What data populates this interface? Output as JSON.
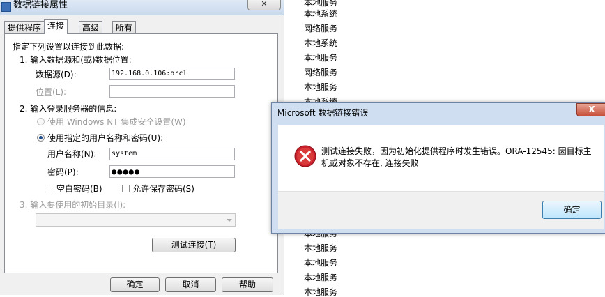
{
  "prop_dialog": {
    "title": "数据链接属性",
    "close_glyph": "✕",
    "tabs": [
      {
        "label": "提供程序"
      },
      {
        "label": "连接"
      },
      {
        "label": "高级"
      },
      {
        "label": "所有"
      }
    ],
    "intro": "指定下列设置以连接到此数据:",
    "step1": "1. 输入数据源和(或)数据位置:",
    "datasource_label": "数据源(D):",
    "datasource_value": "192.168.0.106:orcl",
    "location_label": "位置(L):",
    "location_value": "",
    "step2": "2. 输入登录服务器的信息:",
    "radio_windows": "使用 Windows NT 集成安全设置(W)",
    "radio_specific": "使用指定的用户名称和密码(U):",
    "username_label": "用户名称(N):",
    "username_value": "system",
    "password_label": "密码(P):",
    "password_value": "●●●●●",
    "blank_password": "空白密码(B)",
    "save_password": "允许保存密码(S)",
    "step3": "3. 输入要使用的初始目录(I):",
    "initial_catalog": "",
    "test_button": "测试连接(T)",
    "ok_button": "确定",
    "cancel_button": "取消",
    "help_button": "帮助"
  },
  "background_list": {
    "blurred_top": "服务",
    "items": [
      "本地服务",
      "本地系统",
      "网络服务",
      "本地系统",
      "本地服务",
      "网络服务",
      "本地服务",
      "本地系统",
      "本地服务",
      "本地服务",
      "本地服务",
      "本地服务",
      "本地服务"
    ]
  },
  "error_dialog": {
    "title": "Microsoft 数据链接错误",
    "close_glyph": "X",
    "message": "测试连接失败，因为初始化提供程序时发生错误。ORA-12545: 因目标主机或对象不存在, 连接失败",
    "ok_button": "确定",
    "icon": "error-icon"
  }
}
